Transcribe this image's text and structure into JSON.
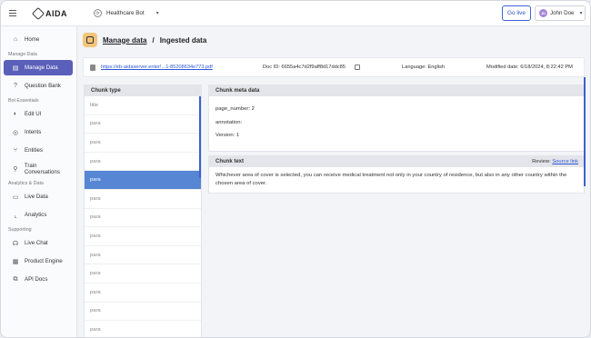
{
  "app": {
    "logo": "AIDA"
  },
  "topbar": {
    "bot_name": "Healthcare Bot",
    "go_live": "Go live",
    "user_initials": "JD",
    "user_name": "John Doe"
  },
  "sidebar": {
    "items": [
      {
        "label": "Home",
        "icon": "home-icon"
      },
      {
        "section": "Manage Data"
      },
      {
        "label": "Manage Data",
        "icon": "database-icon",
        "active": true
      },
      {
        "label": "Question Bank",
        "icon": "question-icon"
      },
      {
        "section": "Bot Essentials"
      },
      {
        "label": "Edit UI",
        "icon": "palette-icon"
      },
      {
        "label": "Intents",
        "icon": "target-icon"
      },
      {
        "label": "Entities",
        "icon": "entities-icon"
      },
      {
        "label": "Train Conversations",
        "icon": "train-icon"
      },
      {
        "section": "Analytics & Data"
      },
      {
        "label": "Live Data",
        "icon": "monitor-icon"
      },
      {
        "label": "Analytics",
        "icon": "chart-icon"
      },
      {
        "section": "Supporting"
      },
      {
        "label": "Live Chat",
        "icon": "headset-icon"
      },
      {
        "label": "Product Engine",
        "icon": "engine-icon"
      },
      {
        "label": "API Docs",
        "icon": "api-icon"
      }
    ]
  },
  "breadcrumb": {
    "parent": "Manage data",
    "sep": "/",
    "current": "Ingested data"
  },
  "doc": {
    "link": "https://eb-aidaserver.enter!...1-85208634e773.pdf",
    "id": "Doc ID: 6655a4c7d2f9aff8d17ddc85",
    "language": "Language: English",
    "modified": "Modified date: 6/18/2024, 8:22:42 PM"
  },
  "chunks": {
    "header": "Chunk type",
    "rows": [
      "title",
      "para",
      "para",
      "para",
      "para",
      "para",
      "para",
      "para",
      "para",
      "para",
      "para",
      "para",
      "para"
    ],
    "selected_index": 4
  },
  "meta": {
    "header": "Chunk meta data",
    "lines": [
      "page_number: 2",
      "annotation:",
      "Version: 1"
    ]
  },
  "chunk_text": {
    "header": "Chunk text",
    "review_label": "Review:",
    "review_link": "Source link",
    "body": "Whichever area of cover is selected, you can receive medical treatment not only in your country of residence, but also in any other country within the chosen area of cover."
  }
}
